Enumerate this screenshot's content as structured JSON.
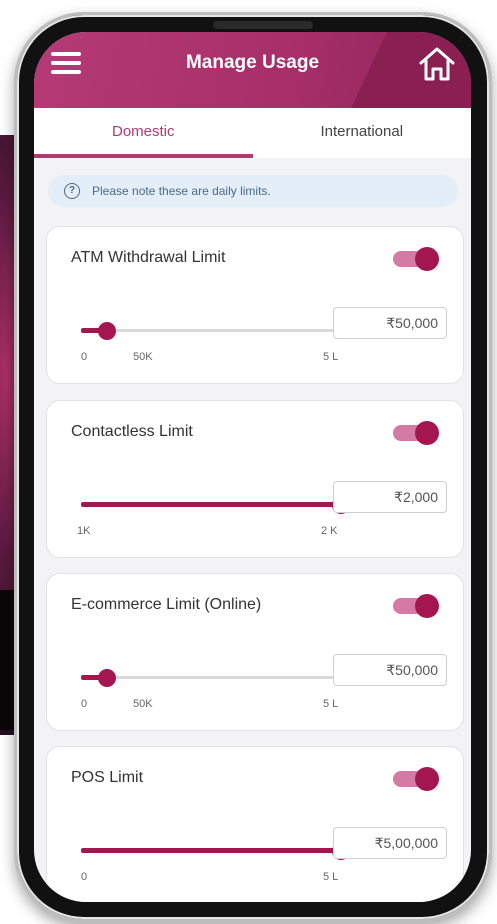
{
  "header": {
    "title": "Manage Usage"
  },
  "tabs": [
    {
      "label": "Domestic",
      "active": true
    },
    {
      "label": "International",
      "active": false
    }
  ],
  "note": "Please note these are daily limits.",
  "limits": [
    {
      "title": "ATM Withdrawal Limit",
      "enabled": true,
      "amount": "₹50,000",
      "ticks": [
        "0",
        "50K",
        "5 L"
      ],
      "level": 0.1
    },
    {
      "title": "Contactless Limit",
      "enabled": true,
      "amount": "₹2,000",
      "ticks": [
        "1K",
        "2 K"
      ],
      "level": 1.0
    },
    {
      "title": "E-commerce Limit (Online)",
      "enabled": true,
      "amount": "₹50,000",
      "ticks": [
        "0",
        "50K",
        "5 L"
      ],
      "level": 0.1
    },
    {
      "title": "POS Limit",
      "enabled": true,
      "amount": "₹5,00,000",
      "ticks": [
        "0",
        "5 L"
      ],
      "level": 1.0
    }
  ],
  "colors": {
    "primary": "#a3164f",
    "header": "#b03a72",
    "toggle_track": "#d47aa4",
    "note_bg": "#e3eef8"
  },
  "icons": {
    "menu": "hamburger-menu-icon",
    "home": "home-icon",
    "info": "info-icon"
  }
}
